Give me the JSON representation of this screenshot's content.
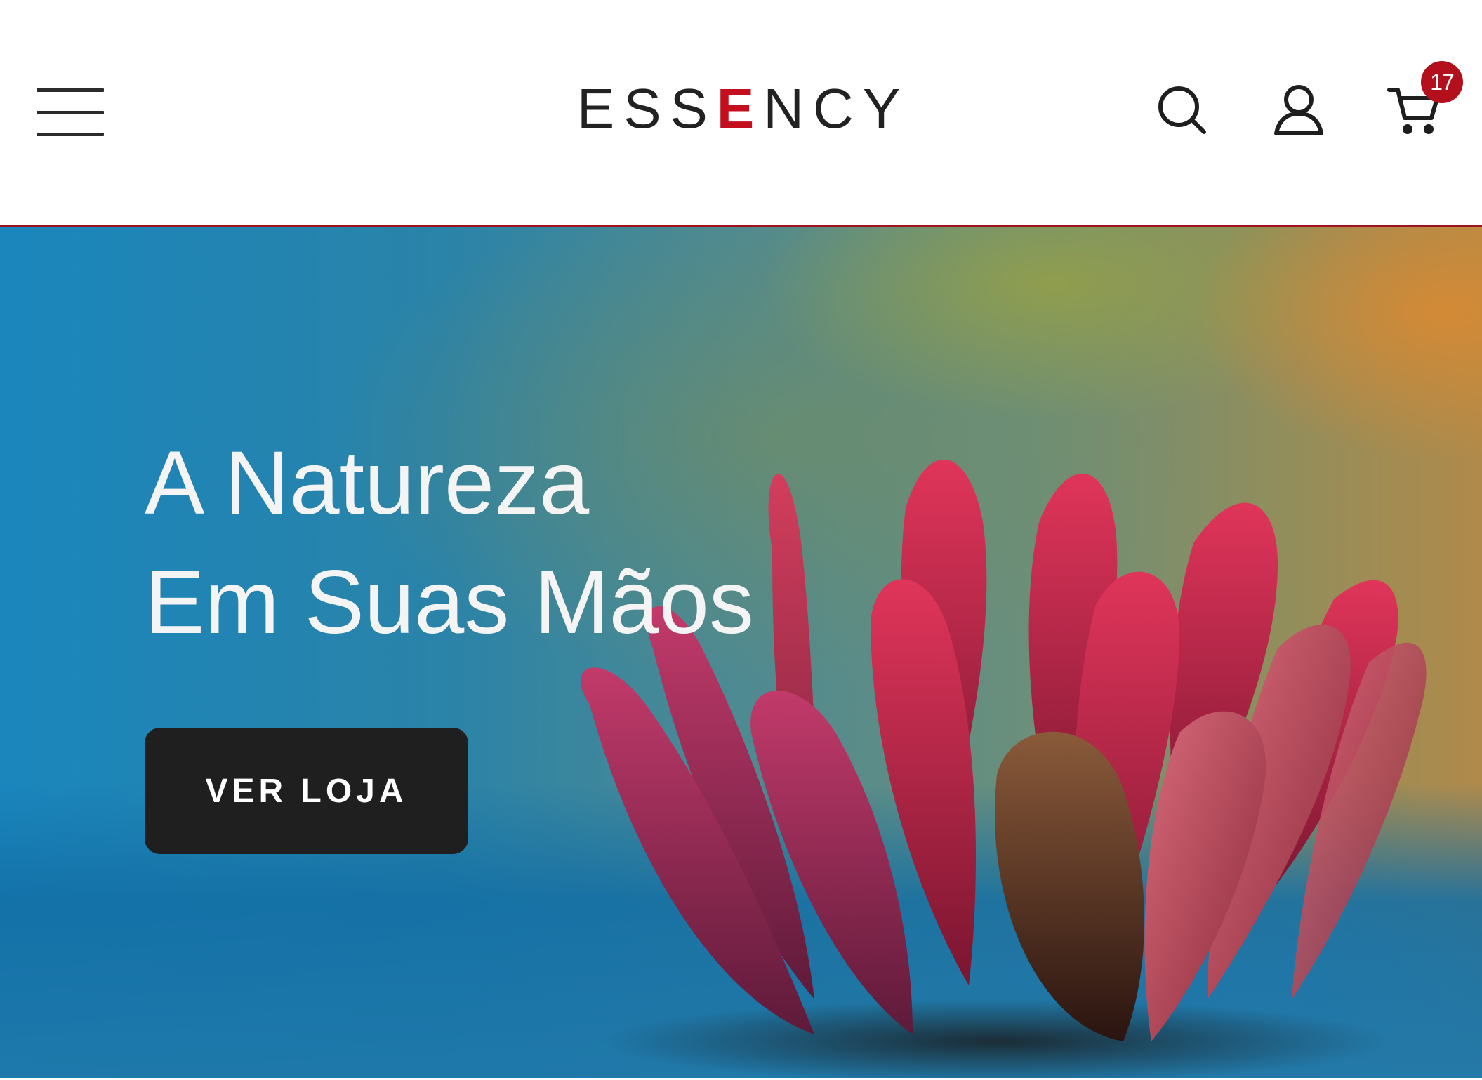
{
  "header": {
    "logo": {
      "part1": "ESS",
      "accent": "E",
      "part2": "NCY",
      "accent_color": "#c4101e"
    },
    "menu_icon": "hamburger-menu-icon",
    "search_icon": "search-icon",
    "account_icon": "user-icon",
    "cart_icon": "cart-icon",
    "cart_count": "17",
    "border_color": "#a0121e"
  },
  "hero": {
    "title_line1": "A Natureza",
    "title_line2": "Em Suas Mãos",
    "cta_label": "VER LOJA",
    "cta_color": "#1f1f1f"
  }
}
